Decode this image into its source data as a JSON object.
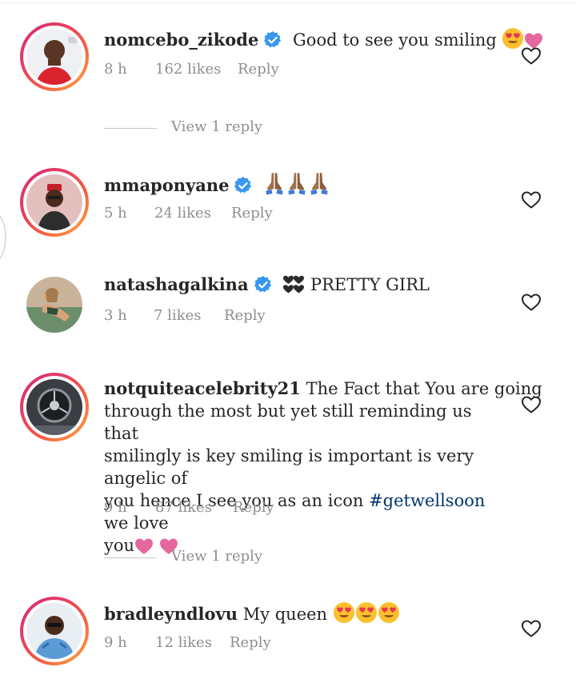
{
  "comments": [
    {
      "username": "nomcebo_zikode",
      "verified": true,
      "text": "Good to see you smiling",
      "time": "8 h",
      "likes": "162 likes",
      "reply": "Reply",
      "view_replies": "View 1 reply",
      "emojis": [
        "smiling-face-with-heart-eyes",
        "pink-heart"
      ]
    },
    {
      "username": "mmaponyane",
      "verified": true,
      "text": "",
      "time": "5 h",
      "likes": "24 likes",
      "reply": "Reply",
      "emojis": [
        "folded-hands",
        "folded-hands",
        "folded-hands"
      ]
    },
    {
      "username": "natashagalkina",
      "verified": true,
      "text": "PRETTY GIRL",
      "time": "3 h",
      "likes": "7 likes",
      "reply": "Reply",
      "emojis": [
        "black-hearts"
      ]
    },
    {
      "username": "notquiteacelebrity21",
      "verified": false,
      "text_line1": "The Fact that You are going",
      "text_rest_1": "through the most but yet still reminding us that",
      "text_rest_2": "smilingly is key smiling is important is very angelic of",
      "text_rest_3": "you hence I see you as an icon",
      "hashtag": "#getwellsoon",
      "text_rest_3b": "we love",
      "text_rest_4": "you",
      "time": "9 h",
      "likes": "87 likes",
      "reply": "Reply",
      "view_replies": "View 1 reply",
      "emojis": [
        "pink-heart",
        "pink-heart"
      ]
    },
    {
      "username": "bradleyndlovu",
      "verified": false,
      "text": "My queen",
      "time": "9 h",
      "likes": "12 likes",
      "reply": "Reply",
      "emojis": [
        "smiling-face-with-heart-eyes",
        "smiling-face-with-heart-eyes",
        "smiling-face-with-heart-eyes"
      ]
    }
  ],
  "colors": {
    "username": "#262626",
    "meta": "#8e8e8e",
    "verified_badge": "#3897f0",
    "hashtag": "#00376b",
    "pink_heart": "#e8669e"
  }
}
